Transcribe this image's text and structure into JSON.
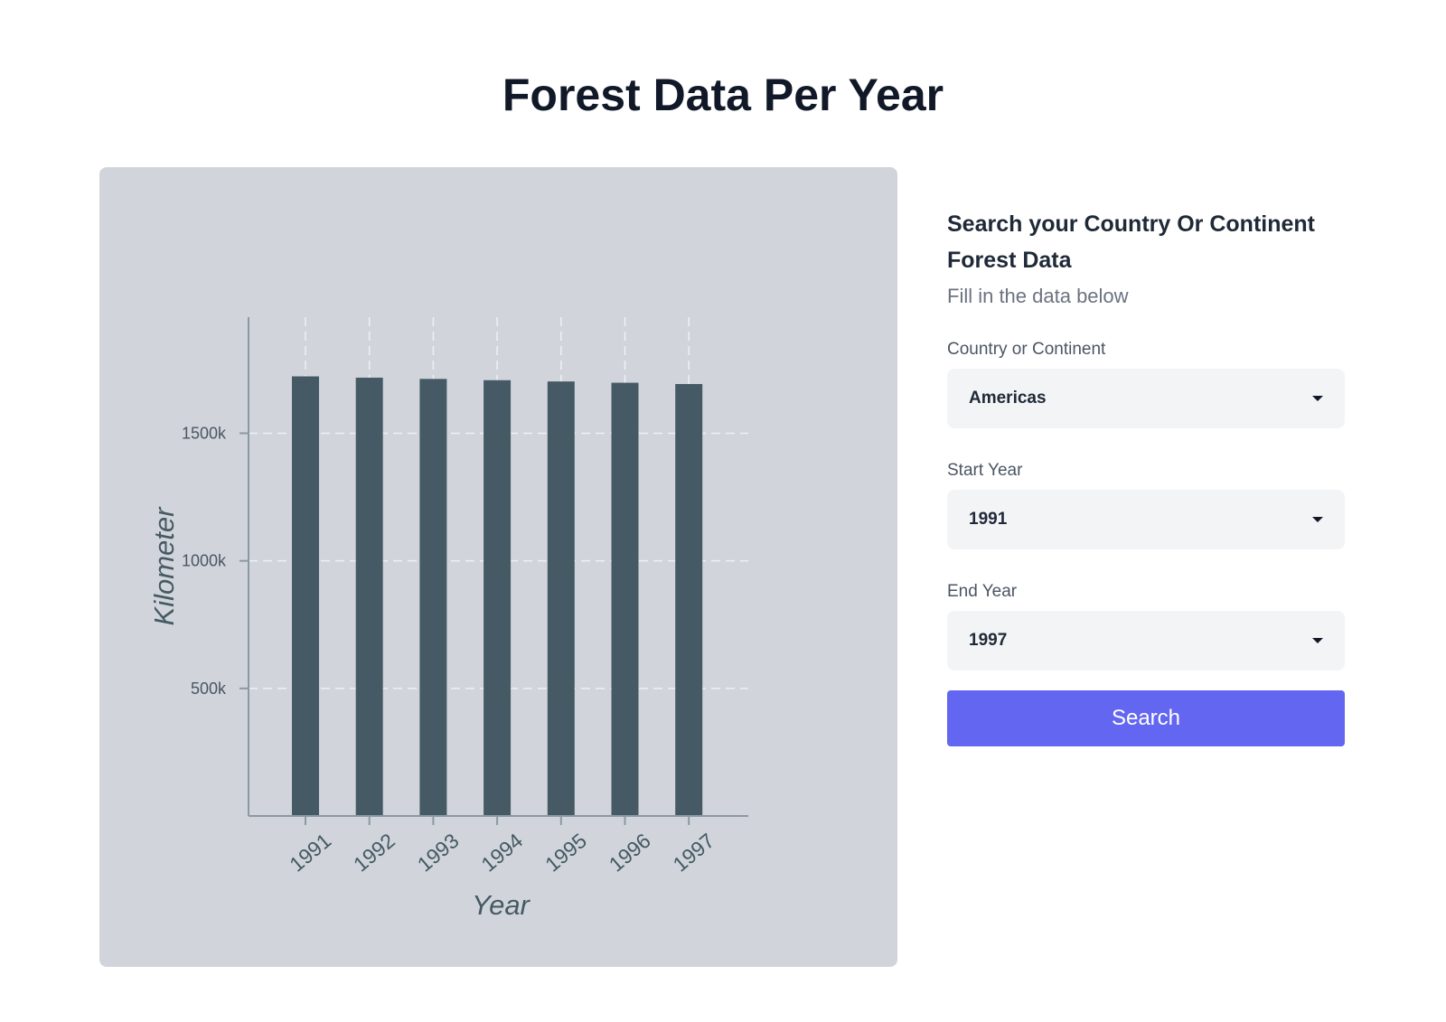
{
  "page": {
    "title": "Forest Data Per Year"
  },
  "form": {
    "heading": "Search your Country Or Continent Forest Data",
    "subheading": "Fill in the data below",
    "country_label": "Country or Continent",
    "country_value": "Americas",
    "start_label": "Start Year",
    "start_value": "1991",
    "end_label": "End Year",
    "end_value": "1997",
    "search_label": "Search"
  },
  "colors": {
    "bar": "#455a64",
    "card_bg": "#d1d5db",
    "button": "#6366f1"
  },
  "chart_data": {
    "type": "bar",
    "title": "",
    "xlabel": "Year",
    "ylabel": "Kilometer",
    "categories": [
      "1991",
      "1992",
      "1993",
      "1994",
      "1995",
      "1996",
      "1997"
    ],
    "values": [
      1723000,
      1718000,
      1713000,
      1708000,
      1703000,
      1698000,
      1693000
    ],
    "yticks": [
      500000,
      1000000,
      1500000
    ],
    "ytick_labels": [
      "500k",
      "1000k",
      "1500k"
    ],
    "ylim": [
      0,
      1955000
    ],
    "grid": true,
    "legend": "none"
  }
}
